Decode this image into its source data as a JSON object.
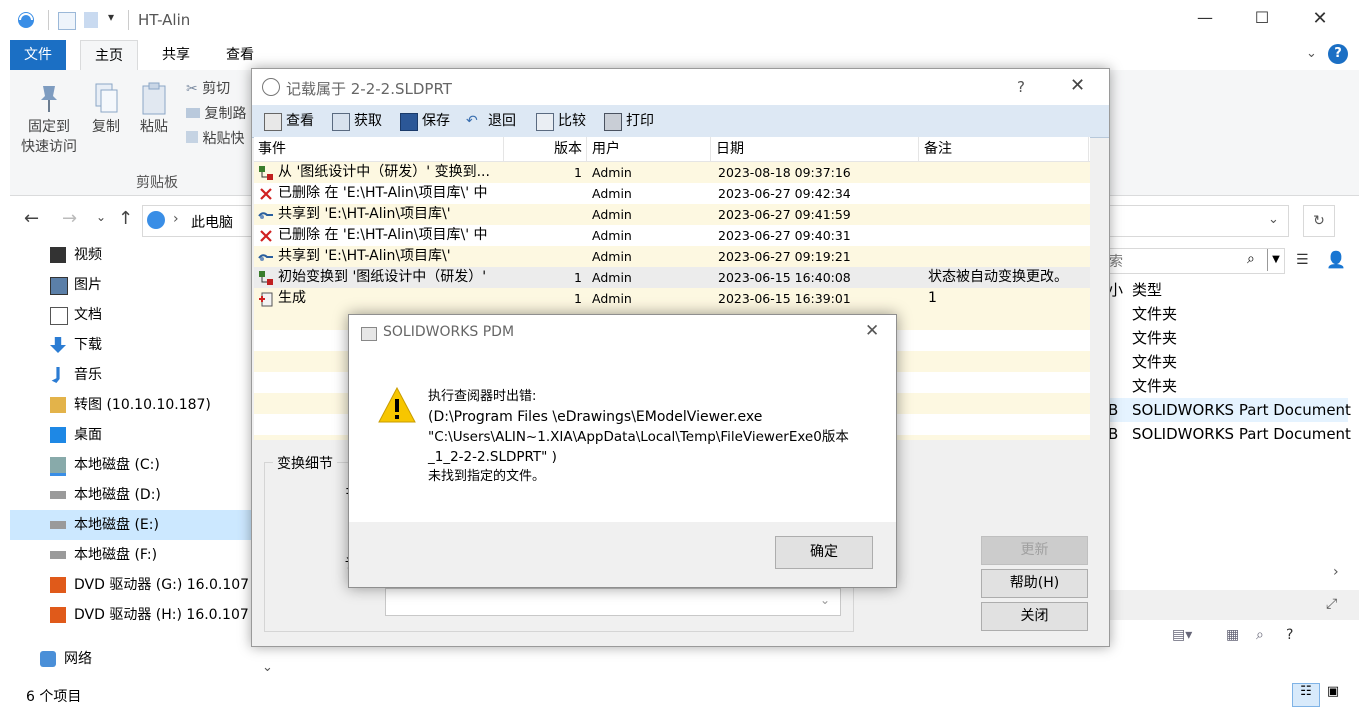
{
  "explorer": {
    "title": "HT-Alin",
    "tabs": [
      "文件",
      "主页",
      "共享",
      "查看"
    ],
    "ribbon": {
      "pin": "固定到",
      "pin2": "快速访问",
      "copy": "复制",
      "paste": "粘贴",
      "cut": "剪切",
      "copy_path": "复制路",
      "paste_shortcut": "粘贴快",
      "group_label": "剪贴板"
    },
    "address": "此电脑",
    "search_placeholder": "索",
    "nav": [
      {
        "label": "视频",
        "icon": "video-icon"
      },
      {
        "label": "图片",
        "icon": "pictures-icon"
      },
      {
        "label": "文档",
        "icon": "documents-icon"
      },
      {
        "label": "下载",
        "icon": "download-icon"
      },
      {
        "label": "音乐",
        "icon": "music-icon"
      },
      {
        "label": "转图 (10.10.10.187)",
        "icon": "network-drive-icon"
      },
      {
        "label": "桌面",
        "icon": "desktop-icon"
      },
      {
        "label": "本地磁盘 (C:)",
        "icon": "drive-c-icon"
      },
      {
        "label": "本地磁盘 (D:)",
        "icon": "drive-icon"
      },
      {
        "label": "本地磁盘 (E:)",
        "icon": "drive-icon"
      },
      {
        "label": "本地磁盘 (F:)",
        "icon": "drive-icon"
      },
      {
        "label": "DVD 驱动器 (G:) 16.0.107",
        "icon": "dvd-icon"
      },
      {
        "label": "DVD 驱动器 (H:) 16.0.107",
        "icon": "dvd-icon"
      }
    ],
    "network": "网络",
    "right_col_header_small": "小",
    "right_col_header": "类型",
    "right_items": [
      {
        "pre": "",
        "type": "文件夹"
      },
      {
        "pre": "",
        "type": "文件夹"
      },
      {
        "pre": "",
        "type": "文件夹"
      },
      {
        "pre": "",
        "type": "文件夹"
      },
      {
        "pre": "B",
        "type": "SOLIDWORKS Part Document"
      },
      {
        "pre": "B",
        "type": "SOLIDWORKS Part Document"
      }
    ],
    "status": "6 个项目"
  },
  "history": {
    "title": "记载属于 2-2-2.SLDPRT",
    "help": "?",
    "toolbar": [
      "查看",
      "获取",
      "保存",
      "退回",
      "比较",
      "打印"
    ],
    "columns": [
      "事件",
      "版本",
      "用户",
      "日期",
      "备注"
    ],
    "rows": [
      {
        "event": "从 '图纸设计中（研发）' 变换到...",
        "ver": "1",
        "user": "Admin",
        "date": "2023-08-18 09:37:16",
        "note": "",
        "icon": "transition-icon"
      },
      {
        "event": "已删除 在 'E:\\HT-Alin\\项目库\\' 中",
        "ver": "",
        "user": "Admin",
        "date": "2023-06-27 09:42:34",
        "note": "",
        "icon": "delete-icon"
      },
      {
        "event": "共享到 'E:\\HT-Alin\\项目库\\'",
        "ver": "",
        "user": "Admin",
        "date": "2023-06-27 09:41:59",
        "note": "",
        "icon": "share-icon"
      },
      {
        "event": "已删除 在 'E:\\HT-Alin\\项目库\\' 中",
        "ver": "",
        "user": "Admin",
        "date": "2023-06-27 09:40:31",
        "note": "",
        "icon": "delete-icon"
      },
      {
        "event": "共享到 'E:\\HT-Alin\\项目库\\'",
        "ver": "",
        "user": "Admin",
        "date": "2023-06-27 09:19:21",
        "note": "",
        "icon": "share-icon"
      },
      {
        "event": "初始变换到 '图纸设计中（研发）'",
        "ver": "1",
        "user": "Admin",
        "date": "2023-06-15 16:40:08",
        "note": "状态被自动变换更改。",
        "icon": "transition-icon"
      },
      {
        "event": "生成",
        "ver": "1",
        "user": "Admin",
        "date": "2023-06-15 16:39:01",
        "note": "1",
        "icon": "create-icon"
      }
    ],
    "detail_label": "变换细节",
    "detail_letters": [
      "±",
      "丿",
      "讠"
    ],
    "buttons": {
      "refresh": "更新",
      "help": "帮助(H)",
      "close": "关闭"
    }
  },
  "error": {
    "title": "SOLIDWORKS PDM",
    "lines": [
      "执行查阅器时出错:",
      "(D:\\Program Files \\eDrawings\\EModelViewer.exe",
      "\"C:\\Users\\ALIN~1.XIA\\AppData\\Local\\Temp\\FileViewerExe0版本",
      "_1_2-2-2.SLDPRT\" )",
      "未找到指定的文件。"
    ],
    "ok": "确定"
  }
}
